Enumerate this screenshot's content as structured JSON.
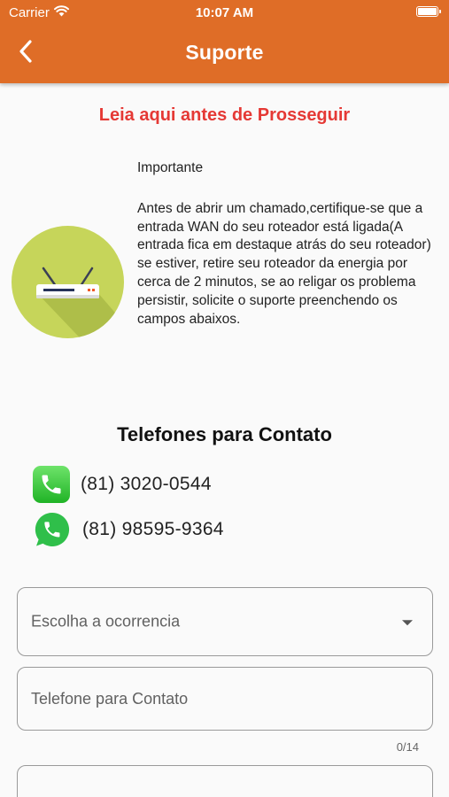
{
  "status_bar": {
    "carrier": "Carrier",
    "time": "10:07 AM",
    "icons": [
      "wifi-icon",
      "battery-icon"
    ]
  },
  "app_bar": {
    "title": "Suporte",
    "back_icon": "chevron-left-icon",
    "color": "#df6d27"
  },
  "notice": {
    "title": "Leia aqui antes de Prosseguir",
    "title_color": "#e53935",
    "heading": "Importante",
    "body": "Antes de abrir um chamado,certifique-se que a entrada WAN do seu roteador está ligada(A entrada fica em destaque atrás do seu roteador) se estiver, retire seu roteador da energia por cerca de 2 minutos, se ao religar os problema persistir, solicite o suporte preenchendo os campos abaixos.",
    "image_icon": "router-icon"
  },
  "contacts": {
    "title": "Telefones para Contato",
    "items": [
      {
        "icon": "phone-icon",
        "number": "(81) 3020-0544"
      },
      {
        "icon": "whatsapp-icon",
        "number": "(81) 98595-9364"
      }
    ]
  },
  "form": {
    "occurrence_select": {
      "placeholder": "Escolha a ocorrencia",
      "icon": "dropdown-arrow-icon"
    },
    "phone_field": {
      "placeholder": "Telefone para Contato",
      "value": "",
      "counter": "0/14"
    }
  }
}
